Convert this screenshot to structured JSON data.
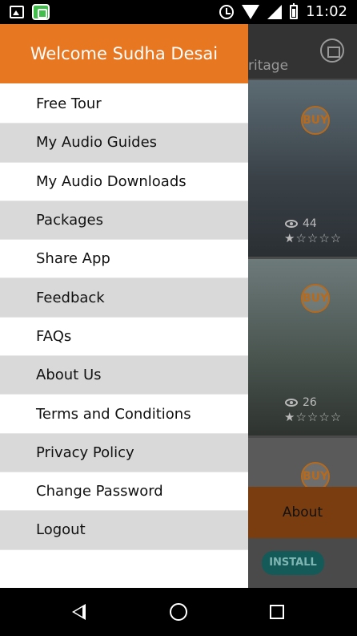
{
  "status_bar": {
    "time": "11:02",
    "left_icons": [
      "gallery-icon",
      "app-notification-icon"
    ],
    "right_icons": [
      "alarm-icon",
      "wifi-icon",
      "signal-icon",
      "battery-icon"
    ]
  },
  "background": {
    "header_partial_title": "ritage",
    "cards": [
      {
        "buy_label": "BUY",
        "views": "44",
        "stars": "★☆☆☆☆"
      },
      {
        "buy_label": "BUY",
        "views": "26",
        "stars": "★☆☆☆☆"
      },
      {
        "buy_label": "BUY"
      }
    ],
    "about_label": "About",
    "install_label": "INSTALL"
  },
  "drawer": {
    "welcome": "Welcome Sudha Desai",
    "menu_items": [
      "Free Tour",
      "My Audio Guides",
      "My Audio Downloads",
      "Packages",
      "Share App",
      "Feedback",
      "FAQs",
      "About Us",
      "Terms and Conditions",
      "Privacy Policy",
      "Change Password",
      "Logout"
    ]
  },
  "colors": {
    "accent": "#e87722",
    "menu_alt_row": "#d9d9d9"
  }
}
